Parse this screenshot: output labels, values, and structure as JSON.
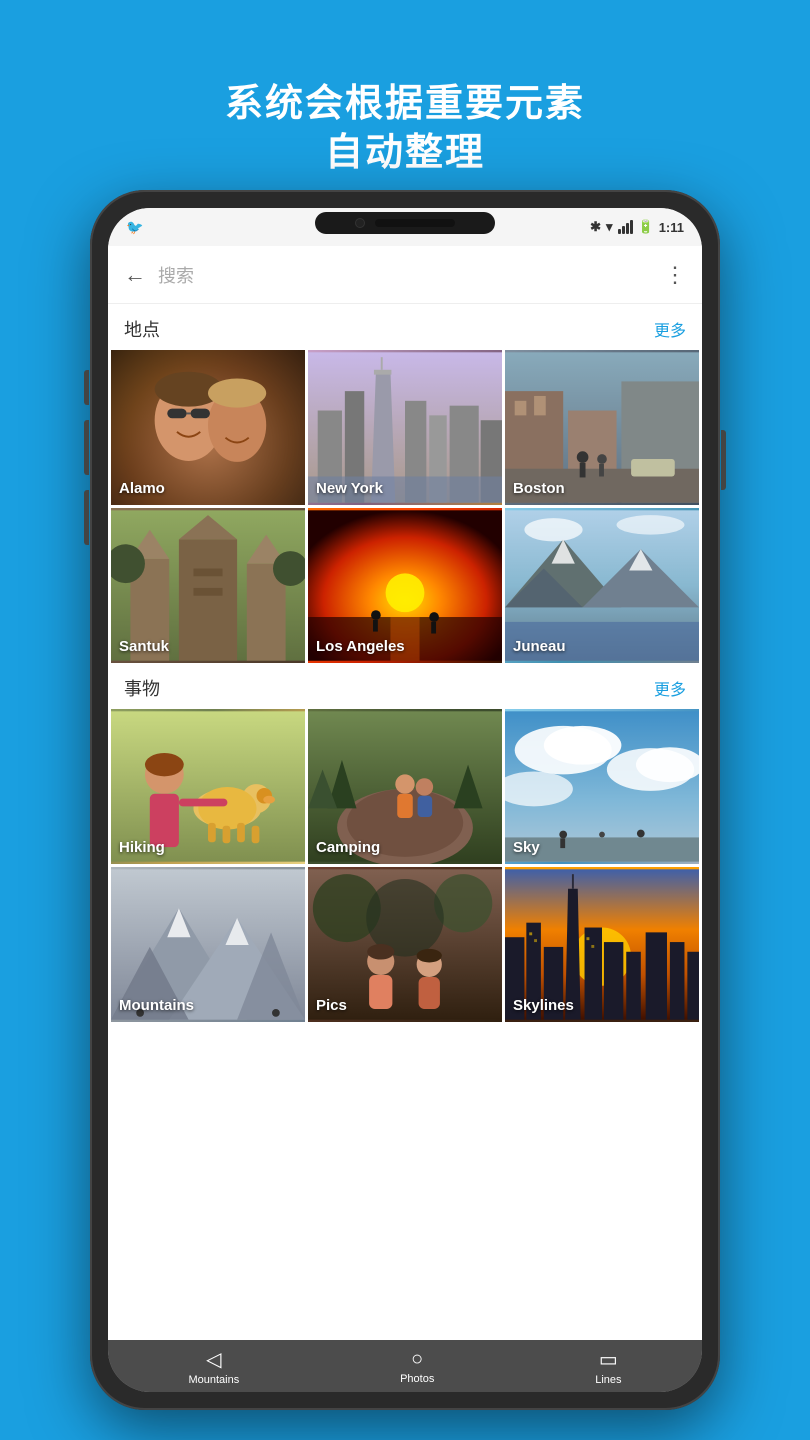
{
  "page": {
    "background_color": "#1a9fe0",
    "header": {
      "line1": "系统会根据重要元素",
      "line2": "自动整理"
    }
  },
  "status_bar": {
    "time": "1:11",
    "icons": [
      "bluetooth",
      "wifi",
      "signal",
      "battery"
    ]
  },
  "app_bar": {
    "back_label": "←",
    "search_placeholder": "搜索",
    "more_label": "⋮"
  },
  "section_places": {
    "title": "地点",
    "more_label": "更多",
    "photos": [
      {
        "id": "alamo",
        "label": "Alamo",
        "style": "alamo"
      },
      {
        "id": "newyork",
        "label": "New York",
        "style": "newyork"
      },
      {
        "id": "boston",
        "label": "Boston",
        "style": "boston"
      },
      {
        "id": "santuk",
        "label": "Santuk",
        "style": "santuk"
      },
      {
        "id": "losangeles",
        "label": "Los Angeles",
        "style": "losangeles"
      },
      {
        "id": "juneau",
        "label": "Juneau",
        "style": "juneau"
      }
    ]
  },
  "section_things": {
    "title": "事物",
    "more_label": "更多",
    "photos": [
      {
        "id": "hiking",
        "label": "Hiking",
        "style": "hiking"
      },
      {
        "id": "camping",
        "label": "Camping",
        "style": "camping"
      },
      {
        "id": "sky",
        "label": "Sky",
        "style": "sky"
      },
      {
        "id": "mountains",
        "label": "Mountains",
        "style": "mountains"
      },
      {
        "id": "pics",
        "label": "Pics",
        "style": "pics"
      },
      {
        "id": "skylines",
        "label": "Skylines",
        "style": "skylines"
      }
    ]
  },
  "bottom_nav": {
    "items": [
      {
        "id": "mountains-nav",
        "label": "Mountains",
        "icon": "◁"
      },
      {
        "id": "photos-nav",
        "label": "Photos",
        "icon": "○"
      },
      {
        "id": "lines-nav",
        "label": "Lines",
        "icon": "▭"
      }
    ]
  }
}
